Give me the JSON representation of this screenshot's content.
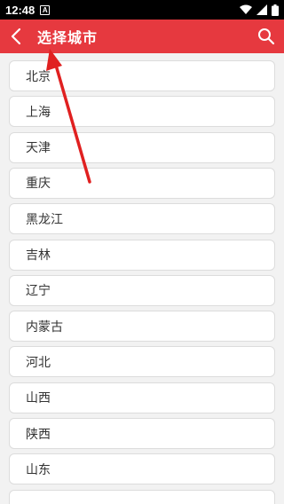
{
  "status_bar": {
    "time": "12:48",
    "notification_glyph": "A"
  },
  "app_bar": {
    "title": "选择城市"
  },
  "cities": [
    "北京",
    "上海",
    "天津",
    "重庆",
    "黑龙江",
    "吉林",
    "辽宁",
    "内蒙古",
    "河北",
    "山西",
    "陕西",
    "山东",
    ""
  ],
  "colors": {
    "appbar": "#e6393f",
    "annotation_arrow": "#e02020"
  },
  "icons": [
    "back-chevron-icon",
    "search-icon",
    "wifi-icon",
    "signal-icon",
    "battery-icon",
    "annotation-arrow"
  ]
}
